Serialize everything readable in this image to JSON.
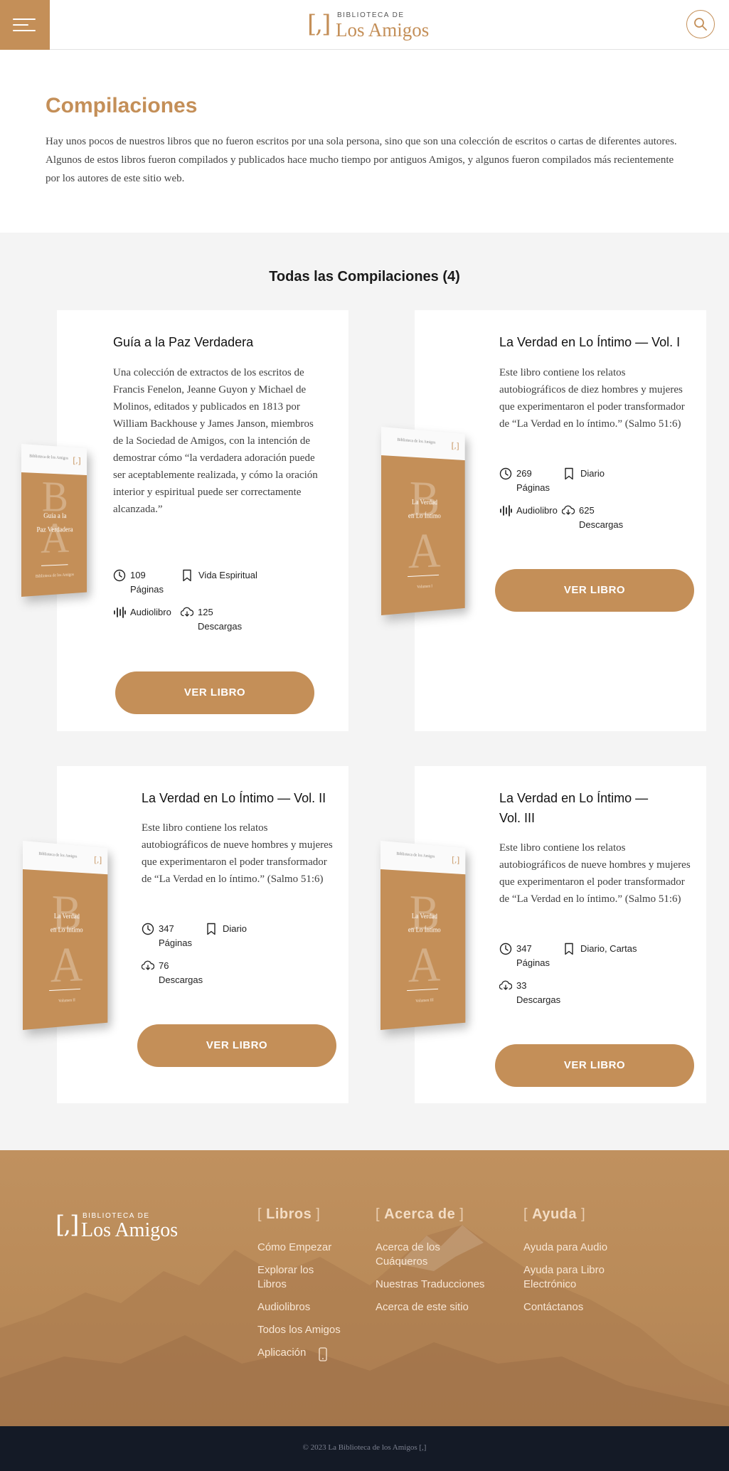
{
  "header": {
    "logo_bracket": "[,]",
    "logo_small": "BIBLIOTECA DE",
    "logo_big": "Los Amigos"
  },
  "intro": {
    "title": "Compilaciones",
    "text": "Hay unos pocos de nuestros libros que no fueron escritos por una sola persona, sino que son una colección de escritos o cartas de diferentes autores. Algunos de estos libros fueron compilados y publicados hace mucho tiempo por antiguos Amigos, y algunos fueron compilados más recientemente por los autores de este sitio web."
  },
  "collection": {
    "heading": "Todas las Compilaciones (4)",
    "books": [
      {
        "title": "Guía a la Paz Verdadera",
        "description": "Una colección de extractos de los escritos de Francis Fenelon, Jeanne Guyon y Michael de Molinos, editados y publicados en 1813 por William Backhouse y James Janson, miembros de la Sociedad de Amigos, con la intención de demostrar cómo “la verdadera adoración puede ser aceptablemente realizada, y cómo la oración interior y espiritual puede ser correctamente alcanzada.”",
        "pages": "109",
        "pages_label": "Páginas",
        "tag": "Vida Espiritual",
        "audiobook": "Audiolibro",
        "downloads": "125",
        "downloads_label": "Descargas",
        "button": "VER LIBRO",
        "cover_title_1": "Guía a la",
        "cover_title_2": "Paz Verdadera",
        "cover_pub": "Biblioteca de los Amigos",
        "cover_bottom": "Biblioteca de los Amigos"
      },
      {
        "title": "La Verdad en Lo Íntimo — Vol. I",
        "description": "Este libro contiene los relatos autobiográficos de diez hombres y mujeres que experimentaron el poder transformador de “La Verdad en lo íntimo.” (Salmo 51:6)",
        "pages": "269",
        "pages_label": "Páginas",
        "tag": "Diario",
        "audiobook": "Audiolibro",
        "downloads": "625",
        "downloads_label": "Descargas",
        "button": "VER LIBRO",
        "cover_title_1": "La Verdad",
        "cover_title_2": "en Lo Íntimo",
        "cover_pub": "Biblioteca de los Amigos",
        "cover_bottom": "Volumen I"
      },
      {
        "title": "La Verdad en Lo Íntimo — Vol. II",
        "description": "Este libro contiene los relatos autobiográficos de nueve hombres y mujeres que experimentaron el poder transformador de “La Verdad en lo íntimo.” (Salmo 51:6)",
        "pages": "347",
        "pages_label": "Páginas",
        "tag": "Diario",
        "downloads": "76",
        "downloads_label": "Descargas",
        "button": "VER LIBRO",
        "cover_title_1": "La Verdad",
        "cover_title_2": "en Lo Íntimo",
        "cover_pub": "Biblioteca de los Amigos",
        "cover_bottom": "Volumen II"
      },
      {
        "title": "La Verdad en Lo Íntimo — Vol. III",
        "description": "Este libro contiene los relatos autobiográficos de nueve hombres y mujeres que experimentaron el poder transformador de “La Verdad en lo íntimo.” (Salmo 51:6)",
        "pages": "347",
        "pages_label": "Páginas",
        "tag": "Diario, Cartas",
        "downloads": "33",
        "downloads_label": "Descargas",
        "button": "VER LIBRO",
        "cover_title_1": "La Verdad",
        "cover_title_2": "en Lo Íntimo",
        "cover_pub": "Biblioteca de los Amigos",
        "cover_bottom": "Volumen III"
      }
    ]
  },
  "footer": {
    "logo_bracket": "[,]",
    "logo_small": "BIBLIOTECA DE",
    "logo_big": "Los Amigos",
    "columns": [
      {
        "title": "Libros",
        "links": [
          "Cómo Empezar",
          "Explorar los Libros",
          "Audiolibros",
          "Todos los Amigos",
          "Aplicación"
        ]
      },
      {
        "title": "Acerca de",
        "links": [
          "Acerca de los Cuáqueros",
          "Nuestras Traducciones",
          "Acerca de este sitio"
        ]
      },
      {
        "title": "Ayuda",
        "links": [
          "Ayuda para Audio",
          "Ayuda para Libro Electrónico",
          "Contáctanos"
        ]
      }
    ],
    "copyright": "© 2023 La Biblioteca de los Amigos [,]"
  },
  "colors": {
    "accent": "#c48f58",
    "copyright_bar": "#141a26",
    "section_bg": "#f4f4f4"
  },
  "icons": [
    "menu-icon",
    "search-icon",
    "clock-icon",
    "bookmark-icon",
    "audio-icon",
    "cloud-download-icon",
    "phone-icon"
  ]
}
